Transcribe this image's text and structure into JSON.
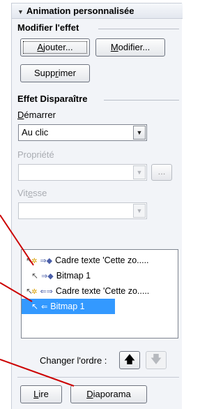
{
  "panel": {
    "title": "Animation personnalisée",
    "modify_section": {
      "label": "Modifier l'effet",
      "add_button": {
        "pre": "",
        "key": "A",
        "post": "jouter..."
      },
      "modify_button": {
        "pre": "",
        "key": "M",
        "post": "odifier..."
      },
      "delete_button": {
        "pre": "Supp",
        "key": "r",
        "post": "imer"
      }
    },
    "effect_section": {
      "label": "Effet Disparaître",
      "start_label": {
        "pre": "",
        "key": "D",
        "post": "émarrer"
      },
      "start_value": "Au clic",
      "property_label": "Propriété",
      "property_value": "",
      "property_more": "...",
      "speed_label": {
        "pre": "Vit",
        "key": "e",
        "post": "sse"
      },
      "speed_value": ""
    },
    "effects_list": [
      {
        "text": "Cadre texte 'Cette zo.....",
        "trigger": "on-click",
        "direction": "in",
        "selected": false
      },
      {
        "text": "Bitmap 1",
        "trigger": "with-previous",
        "direction": "in",
        "selected": false
      },
      {
        "text": "Cadre texte 'Cette zo.....",
        "trigger": "on-click",
        "direction": "out",
        "selected": false
      },
      {
        "text": "Bitmap 1",
        "trigger": "with-previous",
        "direction": "out",
        "selected": true
      }
    ],
    "order": {
      "label": "Changer l'ordre :",
      "up_icon": "arrow-up-icon",
      "down_icon": "arrow-down-icon"
    },
    "play_button": {
      "pre": "",
      "key": "L",
      "post": "ire"
    },
    "slideshow_button": {
      "pre": "",
      "key": "D",
      "post": "iaporama"
    }
  },
  "colors": {
    "panel_bg": "#f2f4f8",
    "selection": "#3399ff",
    "pointer_lines": "#cc0000"
  }
}
